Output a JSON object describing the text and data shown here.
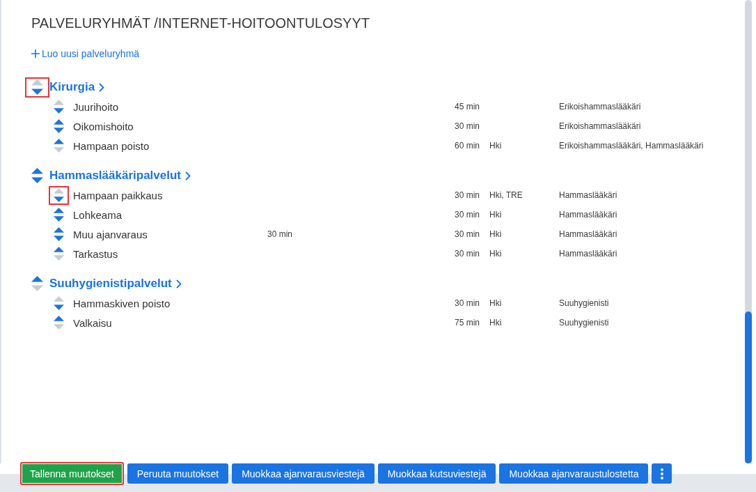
{
  "page": {
    "title": "PALVELURYHMÄT /INTERNET-HOITOONTULOSYYT",
    "create_link": {
      "label": "Luo uusi palveluryhmä"
    }
  },
  "groups": [
    {
      "name": "Kirurgia",
      "can_move_up": false,
      "can_move_down": true,
      "highlighted": true,
      "items": [
        {
          "name": "Juurihoito",
          "duration": "45 min",
          "professions": "Erikoishammaslääkäri",
          "can_move_up": false,
          "can_move_down": true,
          "highlighted": false
        },
        {
          "name": "Oikomishoito",
          "duration": "30 min",
          "professions": "Erikoishammaslääkäri",
          "can_move_up": true,
          "can_move_down": true,
          "highlighted": false
        },
        {
          "name": "Hampaan poisto",
          "duration": "60 min",
          "locations": "Hki",
          "professions": "Erikoishammaslääkäri, Hammaslääkäri",
          "can_move_up": true,
          "can_move_down": false,
          "highlighted": false
        }
      ]
    },
    {
      "name": "Hammaslääkäripalvelut",
      "can_move_up": true,
      "can_move_down": true,
      "highlighted": false,
      "items": [
        {
          "name": "Hampaan paikkaus",
          "duration": "30 min",
          "locations": "Hki, TRE",
          "professions": "Hammaslääkäri",
          "can_move_up": false,
          "can_move_down": true,
          "highlighted": true
        },
        {
          "name": "Lohkeama",
          "duration": "30 min",
          "locations": "Hki",
          "professions": "Hammaslääkäri",
          "can_move_up": true,
          "can_move_down": true,
          "highlighted": false
        },
        {
          "name": "Muu ajanvaraus",
          "column_2": "30 min",
          "duration": "30 min",
          "locations": "Hki",
          "professions": "Hammaslääkäri",
          "can_move_up": true,
          "can_move_down": true,
          "highlighted": false
        },
        {
          "name": "Tarkastus",
          "duration": "30 min",
          "locations": "Hki",
          "professions": "Hammaslääkäri",
          "can_move_up": true,
          "can_move_down": false,
          "highlighted": false
        }
      ]
    },
    {
      "name": "Suuhygienistipalvelut",
      "can_move_up": true,
      "can_move_down": false,
      "highlighted": false,
      "items": [
        {
          "name": "Hammaskiven poisto",
          "duration": "30 min",
          "locations": "Hki",
          "professions": "Suuhygienisti",
          "can_move_up": false,
          "can_move_down": true,
          "highlighted": false
        },
        {
          "name": "Valkaisu",
          "duration": "75 min",
          "locations": "Hki",
          "professions": "Suuhygienisti",
          "can_move_up": true,
          "can_move_down": false,
          "highlighted": false
        }
      ]
    }
  ],
  "footer_buttons": [
    {
      "kind": "primary",
      "label": "Tallenna muutokset",
      "highlighted": true
    },
    {
      "kind": "secondary",
      "label": "Peruuta muutokset",
      "highlighted": false
    },
    {
      "kind": "secondary",
      "label": "Muokkaa ajanvarausviestejä",
      "highlighted": false
    },
    {
      "kind": "secondary",
      "label": "Muokkaa kutsuviestejä",
      "highlighted": false
    },
    {
      "kind": "secondary",
      "label": "Muokkaa ajanvaraustulostetta",
      "highlighted": false
    },
    {
      "kind": "more",
      "highlighted": false
    }
  ]
}
